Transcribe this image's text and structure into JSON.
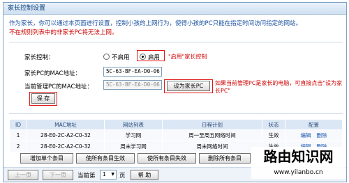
{
  "title": "家长控制设置",
  "desc": {
    "line1": "作为家长，你可以通过本页面进行设置，控制小孩的上网行为，使得小孩的PC只能在指定时间访问指定的网站。",
    "line2": "不在规则列表中的非家长PC将无法上网。"
  },
  "form": {
    "parent_control_label": "家长控制：",
    "disable_label": "不启用",
    "enable_label": "启用",
    "enable_note": "\"启用\"家长控制",
    "parent_mac_label": "家长PC的MAC地址：",
    "parent_mac_value": "5C-63-BF-EA-D0-06",
    "current_mac_label": "当前管理PC的MAC地址：",
    "current_mac_value": "5C-63-BF-EA-D0-06",
    "set_parent_button": "设为家长PC",
    "set_parent_note": "如果当前管理PC是家长的电脑，可直接点击\"设为家长PC\"",
    "save_button": "保 存"
  },
  "table": {
    "headers": [
      "ID",
      "MAC地址",
      "网站列表",
      "日程计划",
      "状态",
      "配置"
    ],
    "rows": [
      {
        "id": "1",
        "mac": "28-E0-2C-A2-C0-32",
        "sites": "学习网",
        "schedule": "周一至周五网络时间",
        "status": "生效",
        "edit": "编辑",
        "delete": "删除"
      },
      {
        "id": "2",
        "mac": "28-E0-2C-A2-C0-32",
        "sites": "周末学习网",
        "schedule": "周末网络时间",
        "status": "生效",
        "edit": "编辑",
        "delete": "删除"
      }
    ]
  },
  "actions": {
    "add": "增加单个条目",
    "enable_all": "使所有条目生效",
    "disable_all": "使所有条目失效",
    "delete_all": "删除所有条目"
  },
  "pagination": {
    "prev": "上一页",
    "next": "下一页",
    "current_label": "当前第",
    "page_value": "1",
    "page_unit": "页",
    "help": "帮 助"
  },
  "watermark": {
    "brand": "路由知识网",
    "url": "www.yilanbo.cn"
  }
}
